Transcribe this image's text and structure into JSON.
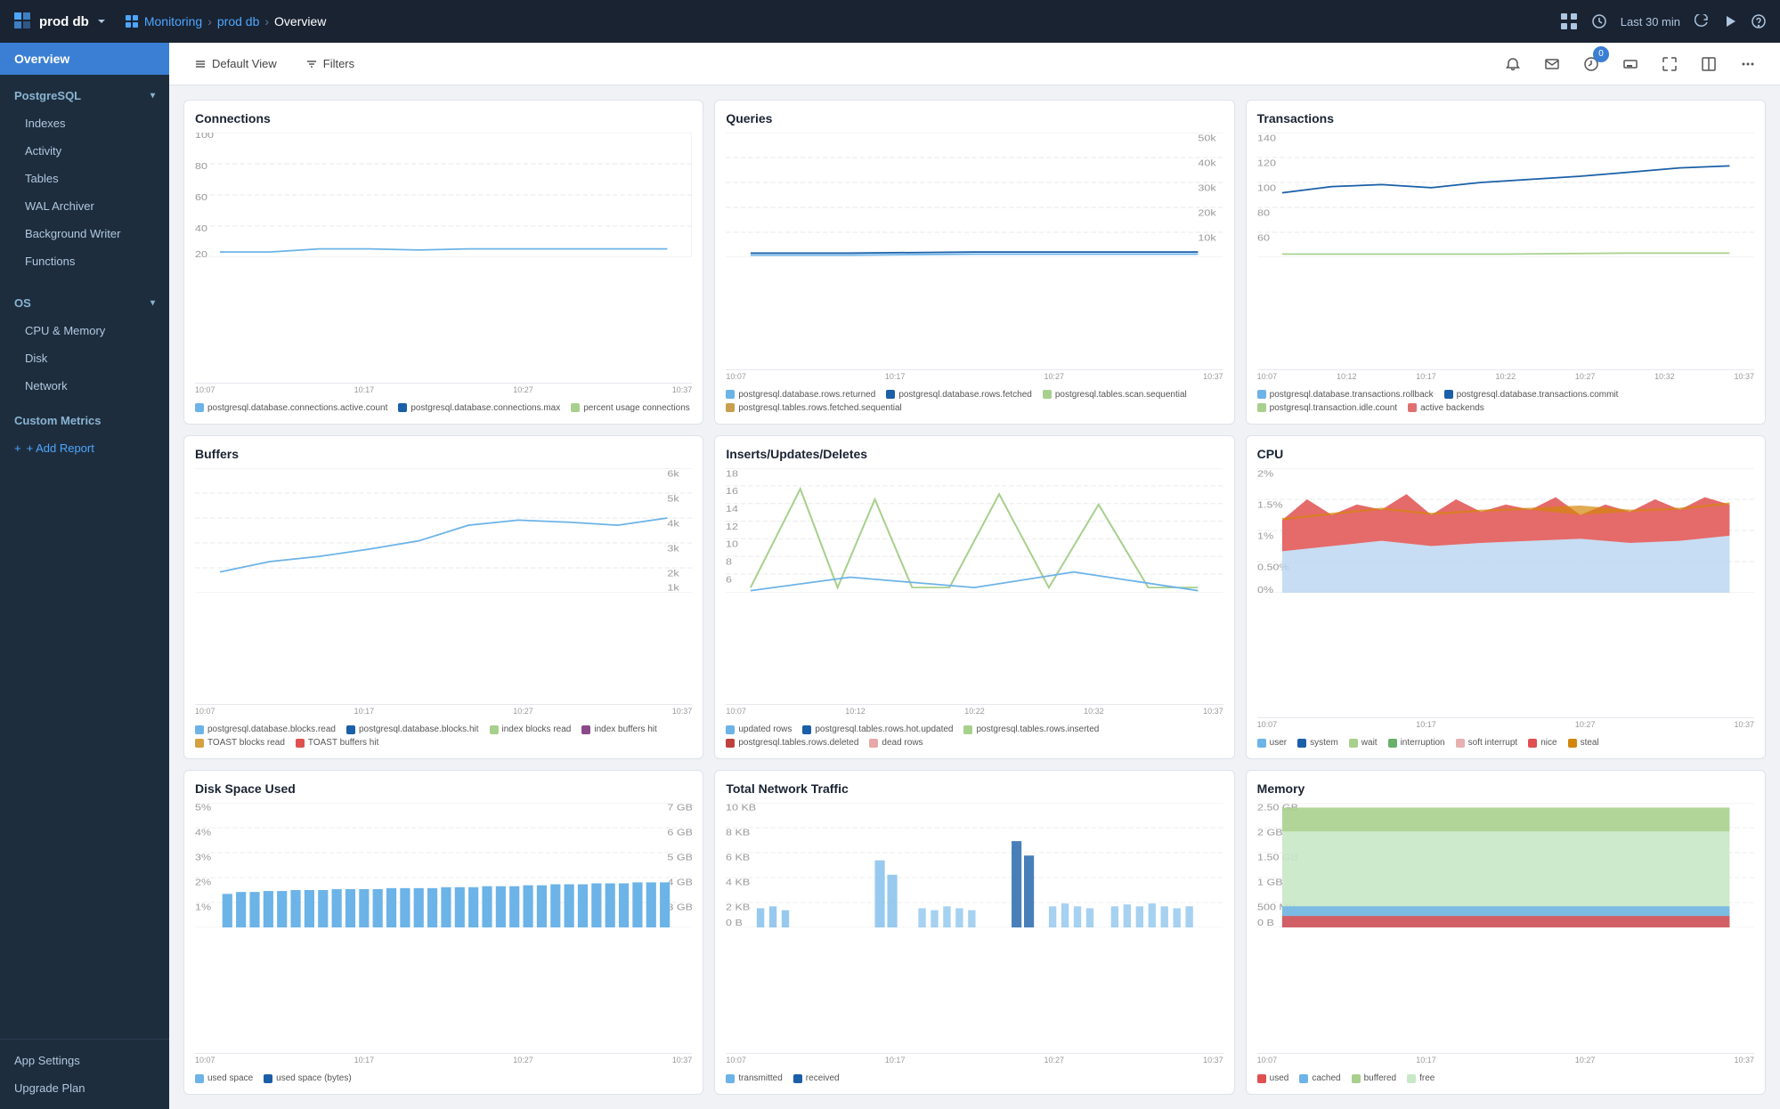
{
  "topbar": {
    "db_name": "prod db",
    "breadcrumb": {
      "monitoring": "Monitoring",
      "sep1": "›",
      "db": "prod db",
      "sep2": "›",
      "page": "Overview"
    },
    "time_range": "Last 30 min",
    "help_icon": "?"
  },
  "toolbar": {
    "default_view_label": "Default View",
    "filters_label": "Filters"
  },
  "sidebar": {
    "overview_label": "Overview",
    "postgresql_label": "PostgreSQL",
    "postgresql_items": [
      {
        "label": "Indexes",
        "id": "indexes"
      },
      {
        "label": "Activity",
        "id": "activity"
      },
      {
        "label": "Tables",
        "id": "tables"
      },
      {
        "label": "WAL Archiver",
        "id": "wal-archiver"
      },
      {
        "label": "Background Writer",
        "id": "background-writer"
      },
      {
        "label": "Functions",
        "id": "functions"
      }
    ],
    "os_label": "OS",
    "os_items": [
      {
        "label": "CPU & Memory",
        "id": "cpu-memory"
      },
      {
        "label": "Disk",
        "id": "disk"
      },
      {
        "label": "Network",
        "id": "network"
      }
    ],
    "custom_metrics_label": "Custom Metrics",
    "add_report_label": "+ Add Report",
    "bottom_items": [
      {
        "label": "App Settings"
      },
      {
        "label": "Upgrade Plan"
      }
    ]
  },
  "charts": {
    "connections": {
      "title": "Connections",
      "x_labels": [
        "10:07",
        "10:17",
        "10:27",
        "10:37"
      ],
      "y_left_max": "100",
      "y_right_max": "1",
      "legend": [
        {
          "color": "#6cb3e8",
          "label": "postgresql.database.connections.active.count"
        },
        {
          "color": "#1a5fa8",
          "label": "postgresql.database.connections.max"
        },
        {
          "color": "#a8d08d",
          "label": "percent usage connections"
        }
      ]
    },
    "queries": {
      "title": "Queries",
      "x_labels": [
        "10:07",
        "10:17",
        "10:27",
        "10:37"
      ],
      "y_right_max": "50k",
      "legend": [
        {
          "color": "#6cb3e8",
          "label": "postgresql.database.rows.returned"
        },
        {
          "color": "#1a5fa8",
          "label": "postgresql.database.rows.fetched"
        },
        {
          "color": "#a8d08d",
          "label": "postgresql.tables.scan.sequential"
        },
        {
          "color": "#c8a050",
          "label": "postgresql.tables.rows.fetched.sequential"
        }
      ]
    },
    "transactions": {
      "title": "Transactions",
      "x_labels": [
        "10:07",
        "10:12",
        "10:17",
        "10:22",
        "10:27",
        "10:32",
        "10:37"
      ],
      "legend": [
        {
          "color": "#6cb3e8",
          "label": "postgresql.database.transactions.rollback"
        },
        {
          "color": "#1a5fa8",
          "label": "postgresql.database.transactions.commit"
        },
        {
          "color": "#a8d08d",
          "label": "postgresql.transaction.idle.count"
        },
        {
          "color": "#e07070",
          "label": "active backends"
        }
      ]
    },
    "buffers": {
      "title": "Buffers",
      "x_labels": [
        "10:07",
        "10:17",
        "10:27",
        "10:37"
      ],
      "legend": [
        {
          "color": "#6cb3e8",
          "label": "postgresql.database.blocks.read"
        },
        {
          "color": "#1a5fa8",
          "label": "postgresql.database.blocks.hit"
        },
        {
          "color": "#a8d08d",
          "label": "index blocks read"
        },
        {
          "color": "#8a4a8a",
          "label": "index buffers hit"
        },
        {
          "color": "#d4a040",
          "label": "TOAST blocks read"
        },
        {
          "color": "#e05050",
          "label": "TOAST buffers hit"
        }
      ]
    },
    "inserts_updates_deletes": {
      "title": "Inserts/Updates/Deletes",
      "x_labels": [
        "10:07",
        "10:12",
        "10:22",
        "10:32",
        "10:37"
      ],
      "legend": [
        {
          "color": "#6cb3e8",
          "label": "updated rows"
        },
        {
          "color": "#1a5fa8",
          "label": "postgresql.tables.rows.hot.updated"
        },
        {
          "color": "#a8d08d",
          "label": "postgresql.tables.rows.inserted"
        },
        {
          "color": "#c04040",
          "label": "postgresql.tables.rows.deleted"
        },
        {
          "color": "#e8a8a8",
          "label": "dead rows"
        }
      ]
    },
    "cpu": {
      "title": "CPU",
      "x_labels": [
        "10:07",
        "10:17",
        "10:27",
        "10:37"
      ],
      "legend": [
        {
          "color": "#6cb3e8",
          "label": "user"
        },
        {
          "color": "#1a5fa8",
          "label": "system"
        },
        {
          "color": "#a8d08d",
          "label": "wait"
        },
        {
          "color": "#6ab06a",
          "label": "interruption"
        },
        {
          "color": "#e8b0b0",
          "label": "soft interrupt"
        },
        {
          "color": "#e05050",
          "label": "nice"
        },
        {
          "color": "#d4860a",
          "label": "steal"
        }
      ]
    },
    "disk_space": {
      "title": "Disk Space Used",
      "x_labels": [
        "10:07",
        "10:17",
        "10:27",
        "10:37"
      ],
      "legend": [
        {
          "color": "#6cb3e8",
          "label": "used space"
        },
        {
          "color": "#1a5fa8",
          "label": "used space (bytes)"
        }
      ]
    },
    "network_traffic": {
      "title": "Total Network Traffic",
      "x_labels": [
        "10:07",
        "10:17",
        "10:27",
        "10:37"
      ],
      "legend": [
        {
          "color": "#6cb3e8",
          "label": "transmitted"
        },
        {
          "color": "#1a5fa8",
          "label": "received"
        }
      ]
    },
    "memory": {
      "title": "Memory",
      "x_labels": [
        "10:07",
        "10:17",
        "10:27",
        "10:37"
      ],
      "legend": [
        {
          "color": "#e05050",
          "label": "used"
        },
        {
          "color": "#6cb3e8",
          "label": "cached"
        },
        {
          "color": "#a8d08d",
          "label": "buffered"
        },
        {
          "color": "#c8e8c8",
          "label": "free"
        }
      ]
    }
  }
}
